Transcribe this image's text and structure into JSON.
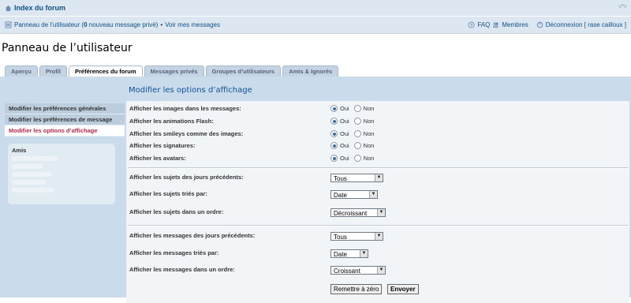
{
  "header": {
    "index_link": "Index du forum",
    "collapse_glyph": "<^>",
    "panel_link": "Panneau de l’utilisateur (",
    "new_pm_count": "0",
    "new_pm_suffix": " nouveau message privé)",
    "separator_bullet": "•",
    "view_messages": "Voir mes messages",
    "faq": "FAQ",
    "members": "Membres",
    "logout": "Déconnexion [ rase cailloux ]"
  },
  "page_title": "Panneau de l’utilisateur",
  "tabs": [
    {
      "label": "Aperçu"
    },
    {
      "label": "Profil"
    },
    {
      "label": "Préférences du forum"
    },
    {
      "label": "Messages privés"
    },
    {
      "label": "Groupes d’utilisateurs"
    },
    {
      "label": "Amis & Ignorés"
    }
  ],
  "sidebar": {
    "items": [
      {
        "label": "Modifier les préférences générales"
      },
      {
        "label": "Modifier les préférences de message"
      },
      {
        "label": "Modifier les options d’affichage"
      }
    ],
    "friends_title": "Amis"
  },
  "form": {
    "heading": "Modifier les options d’affichage",
    "yes_label": "Oui",
    "no_label": "Non",
    "radio_rows": [
      {
        "label": "Afficher les images dans les messages:",
        "value": "Oui"
      },
      {
        "label": "Afficher les animations Flash:",
        "value": "Oui"
      },
      {
        "label": "Afficher les smileys comme des images:",
        "value": "Oui"
      },
      {
        "label": "Afficher les signatures:",
        "value": "Oui"
      },
      {
        "label": "Afficher les avatars:",
        "value": "Oui"
      }
    ],
    "topic_rows": [
      {
        "label": "Afficher les sujets des jours précédents:",
        "value": "Tous"
      },
      {
        "label": "Afficher les sujets triés par:",
        "value": "Date"
      },
      {
        "label": "Afficher les sujets dans un ordre:",
        "value": "Décroissant"
      }
    ],
    "post_rows": [
      {
        "label": "Afficher les messages des jours précédents:",
        "value": "Tous"
      },
      {
        "label": "Afficher les messages triés par:",
        "value": "Date"
      },
      {
        "label": "Afficher les messages dans un ordre:",
        "value": "Croissant"
      }
    ],
    "reset_button": "Remettre à zéro",
    "submit_button": "Envoyer"
  }
}
